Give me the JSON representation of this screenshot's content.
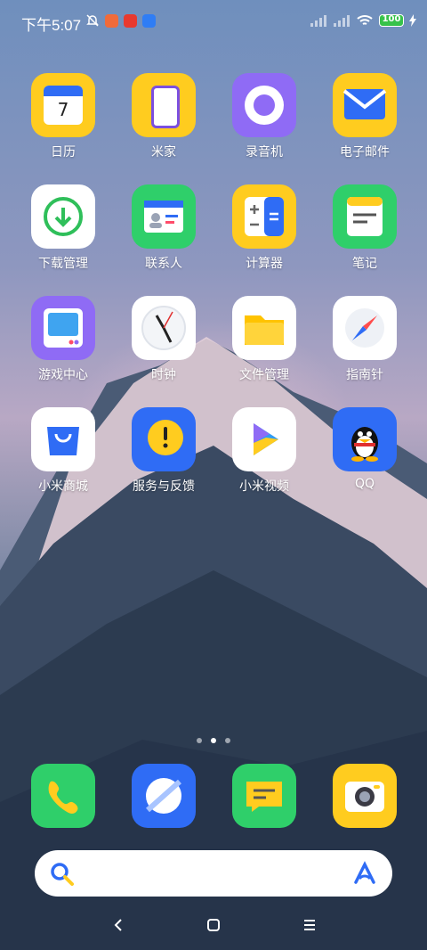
{
  "status": {
    "time": "下午5:07",
    "battery": "100"
  },
  "apps": [
    {
      "label": "日历",
      "icon": "calendar-icon",
      "date": "7"
    },
    {
      "label": "米家",
      "icon": "mijia-icon"
    },
    {
      "label": "录音机",
      "icon": "recorder-icon"
    },
    {
      "label": "电子邮件",
      "icon": "mail-icon"
    },
    {
      "label": "下载管理",
      "icon": "download-icon"
    },
    {
      "label": "联系人",
      "icon": "contacts-icon"
    },
    {
      "label": "计算器",
      "icon": "calculator-icon"
    },
    {
      "label": "笔记",
      "icon": "notes-icon"
    },
    {
      "label": "游戏中心",
      "icon": "game-center-icon"
    },
    {
      "label": "时钟",
      "icon": "clock-icon"
    },
    {
      "label": "文件管理",
      "icon": "folder-icon"
    },
    {
      "label": "指南针",
      "icon": "compass-icon"
    },
    {
      "label": "小米商城",
      "icon": "mi-store-icon"
    },
    {
      "label": "服务与反馈",
      "icon": "feedback-icon"
    },
    {
      "label": "小米视频",
      "icon": "video-icon"
    },
    {
      "label": "QQ",
      "icon": "qq-icon"
    }
  ],
  "dock": [
    {
      "icon": "phone-icon"
    },
    {
      "icon": "browser-icon"
    },
    {
      "icon": "messages-icon"
    },
    {
      "icon": "camera-icon"
    }
  ],
  "pages": {
    "count": 3,
    "active": 1
  },
  "colors": {
    "yellow": "#ffcc1f",
    "green": "#2fcf6a",
    "purple": "#8f6bf5",
    "blue": "#2f6cf5",
    "white": "#ffffff"
  }
}
